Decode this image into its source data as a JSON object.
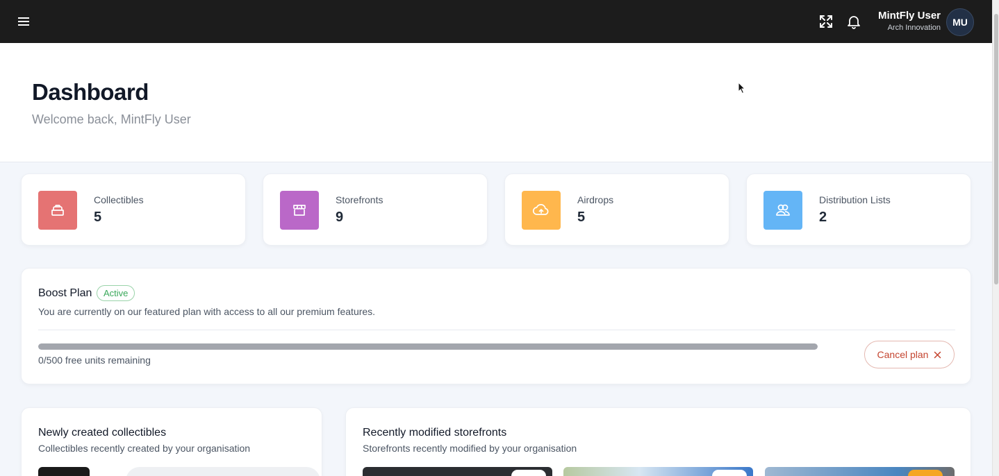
{
  "topbar": {
    "user_name": "MintFly User",
    "user_org": "Arch Innovation",
    "avatar_initials": "MU",
    "icons": [
      "menu-icon",
      "fullscreen-icon",
      "bell-icon"
    ]
  },
  "header": {
    "title": "Dashboard",
    "subtitle": "Welcome back, MintFly User"
  },
  "stats": [
    {
      "label": "Collectibles",
      "value": "5",
      "icon": "box-icon",
      "color": "#e57373"
    },
    {
      "label": "Storefronts",
      "value": "9",
      "icon": "store-icon",
      "color": "#ba68c8"
    },
    {
      "label": "Airdrops",
      "value": "5",
      "icon": "cloud-upload-icon",
      "color": "#ffb74d"
    },
    {
      "label": "Distribution Lists",
      "value": "2",
      "icon": "users-icon",
      "color": "#64b5f6"
    }
  ],
  "plan": {
    "title": "Boost Plan",
    "badge": "Active",
    "description": "You are currently on our featured plan with access to all our premium features.",
    "units_label": "0/500 free units remaining",
    "progress_fraction": 1.0,
    "cancel_label": "Cancel plan"
  },
  "collectibles_panel": {
    "title": "Newly created collectibles",
    "subtitle": "Collectibles recently created by your organisation"
  },
  "storefronts_panel": {
    "title": "Recently modified storefronts",
    "subtitle": "Storefronts recently modified by your organisation"
  },
  "colors": {
    "topbar": "#1c1c1c",
    "active_badge": "#3aa85a",
    "cancel": "#c4442f"
  }
}
